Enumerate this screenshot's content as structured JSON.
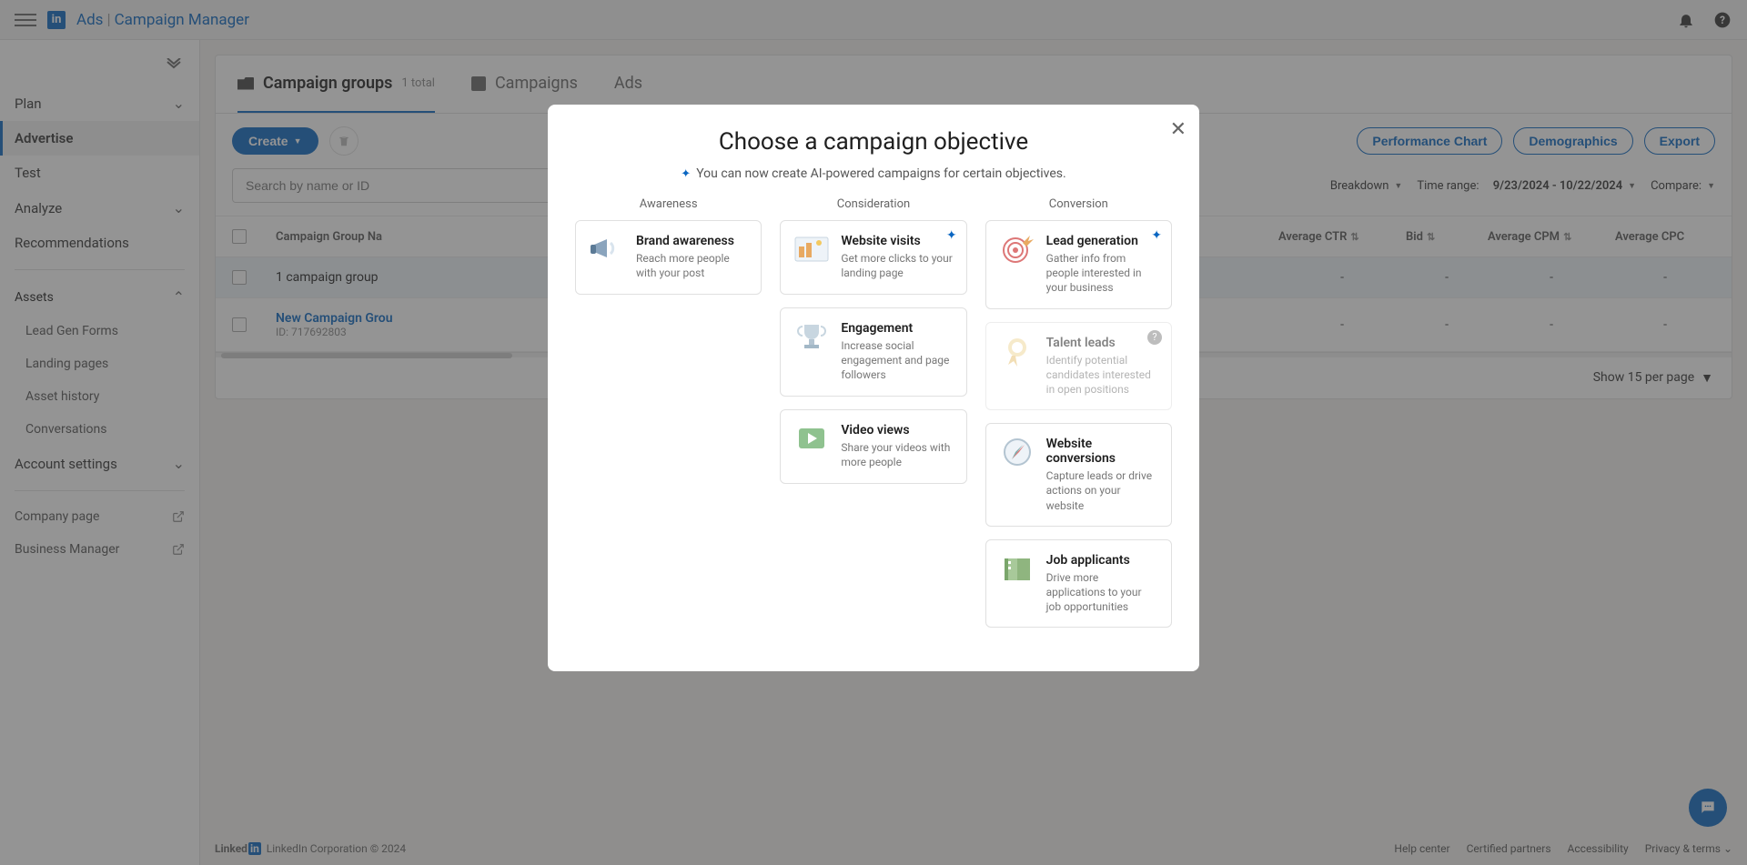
{
  "header": {
    "brand_ads": "Ads",
    "brand_cm": "Campaign Manager"
  },
  "sidebar": {
    "plan": "Plan",
    "advertise": "Advertise",
    "test": "Test",
    "analyze": "Analyze",
    "recommendations": "Recommendations",
    "assets": "Assets",
    "assets_children": {
      "lead_gen": "Lead Gen Forms",
      "landing": "Landing pages",
      "asset_history": "Asset history",
      "conversations": "Conversations"
    },
    "account_settings": "Account settings",
    "company_page": "Company page",
    "business_manager": "Business Manager"
  },
  "tabs": {
    "cg": "Campaign groups",
    "cg_count": "1 total",
    "campaigns": "Campaigns",
    "ads": "Ads"
  },
  "toolbar": {
    "create": "Create",
    "perf_chart": "Performance Chart",
    "demographics": "Demographics",
    "export": "Export"
  },
  "filters": {
    "search_ph": "Search by name or ID",
    "breakdown": "Breakdown",
    "time_label": "Time range:",
    "time_value": "9/23/2024 - 10/22/2024",
    "compare": "Compare:"
  },
  "columns": {
    "name": "Campaign Group Na",
    "ctr": "Average CTR",
    "bid": "Bid",
    "cpm": "Average CPM",
    "cpc": "Average CPC"
  },
  "rows": [
    {
      "name": "1 campaign group",
      "id": "",
      "ctr": "-",
      "bid": "-",
      "cpm": "-",
      "cpc": "-"
    },
    {
      "name": "New Campaign Grou",
      "id": "ID: 717692803",
      "ctr": "-",
      "bid": "-",
      "cpm": "-",
      "cpc": "-"
    }
  ],
  "pager": "Show 15 per page",
  "footer": {
    "logo1": "Linked",
    "logo2": "in",
    "copy": "LinkedIn Corporation © 2024",
    "links": {
      "help": "Help center",
      "cert": "Certified partners",
      "a11y": "Accessibility",
      "privacy": "Privacy & terms"
    }
  },
  "dialog": {
    "title": "Choose a campaign objective",
    "sub": "You can now create AI-powered campaigns for certain objectives.",
    "cols": {
      "awareness": "Awareness",
      "consideration": "Consideration",
      "conversion": "Conversion"
    },
    "objectives": {
      "brand_awareness": {
        "t": "Brand awareness",
        "d": "Reach more people with your post"
      },
      "website_visits": {
        "t": "Website visits",
        "d": "Get more clicks to your landing page"
      },
      "engagement": {
        "t": "Engagement",
        "d": "Increase social engagement and page followers"
      },
      "video_views": {
        "t": "Video views",
        "d": "Share your videos with more people"
      },
      "lead_gen": {
        "t": "Lead generation",
        "d": "Gather info from people interested in your business"
      },
      "talent": {
        "t": "Talent leads",
        "d": "Identify potential candidates interested in open positions"
      },
      "conversions": {
        "t": "Website conversions",
        "d": "Capture leads or drive actions on your website"
      },
      "jobs": {
        "t": "Job applicants",
        "d": "Drive more applications to your job opportunities"
      }
    }
  }
}
